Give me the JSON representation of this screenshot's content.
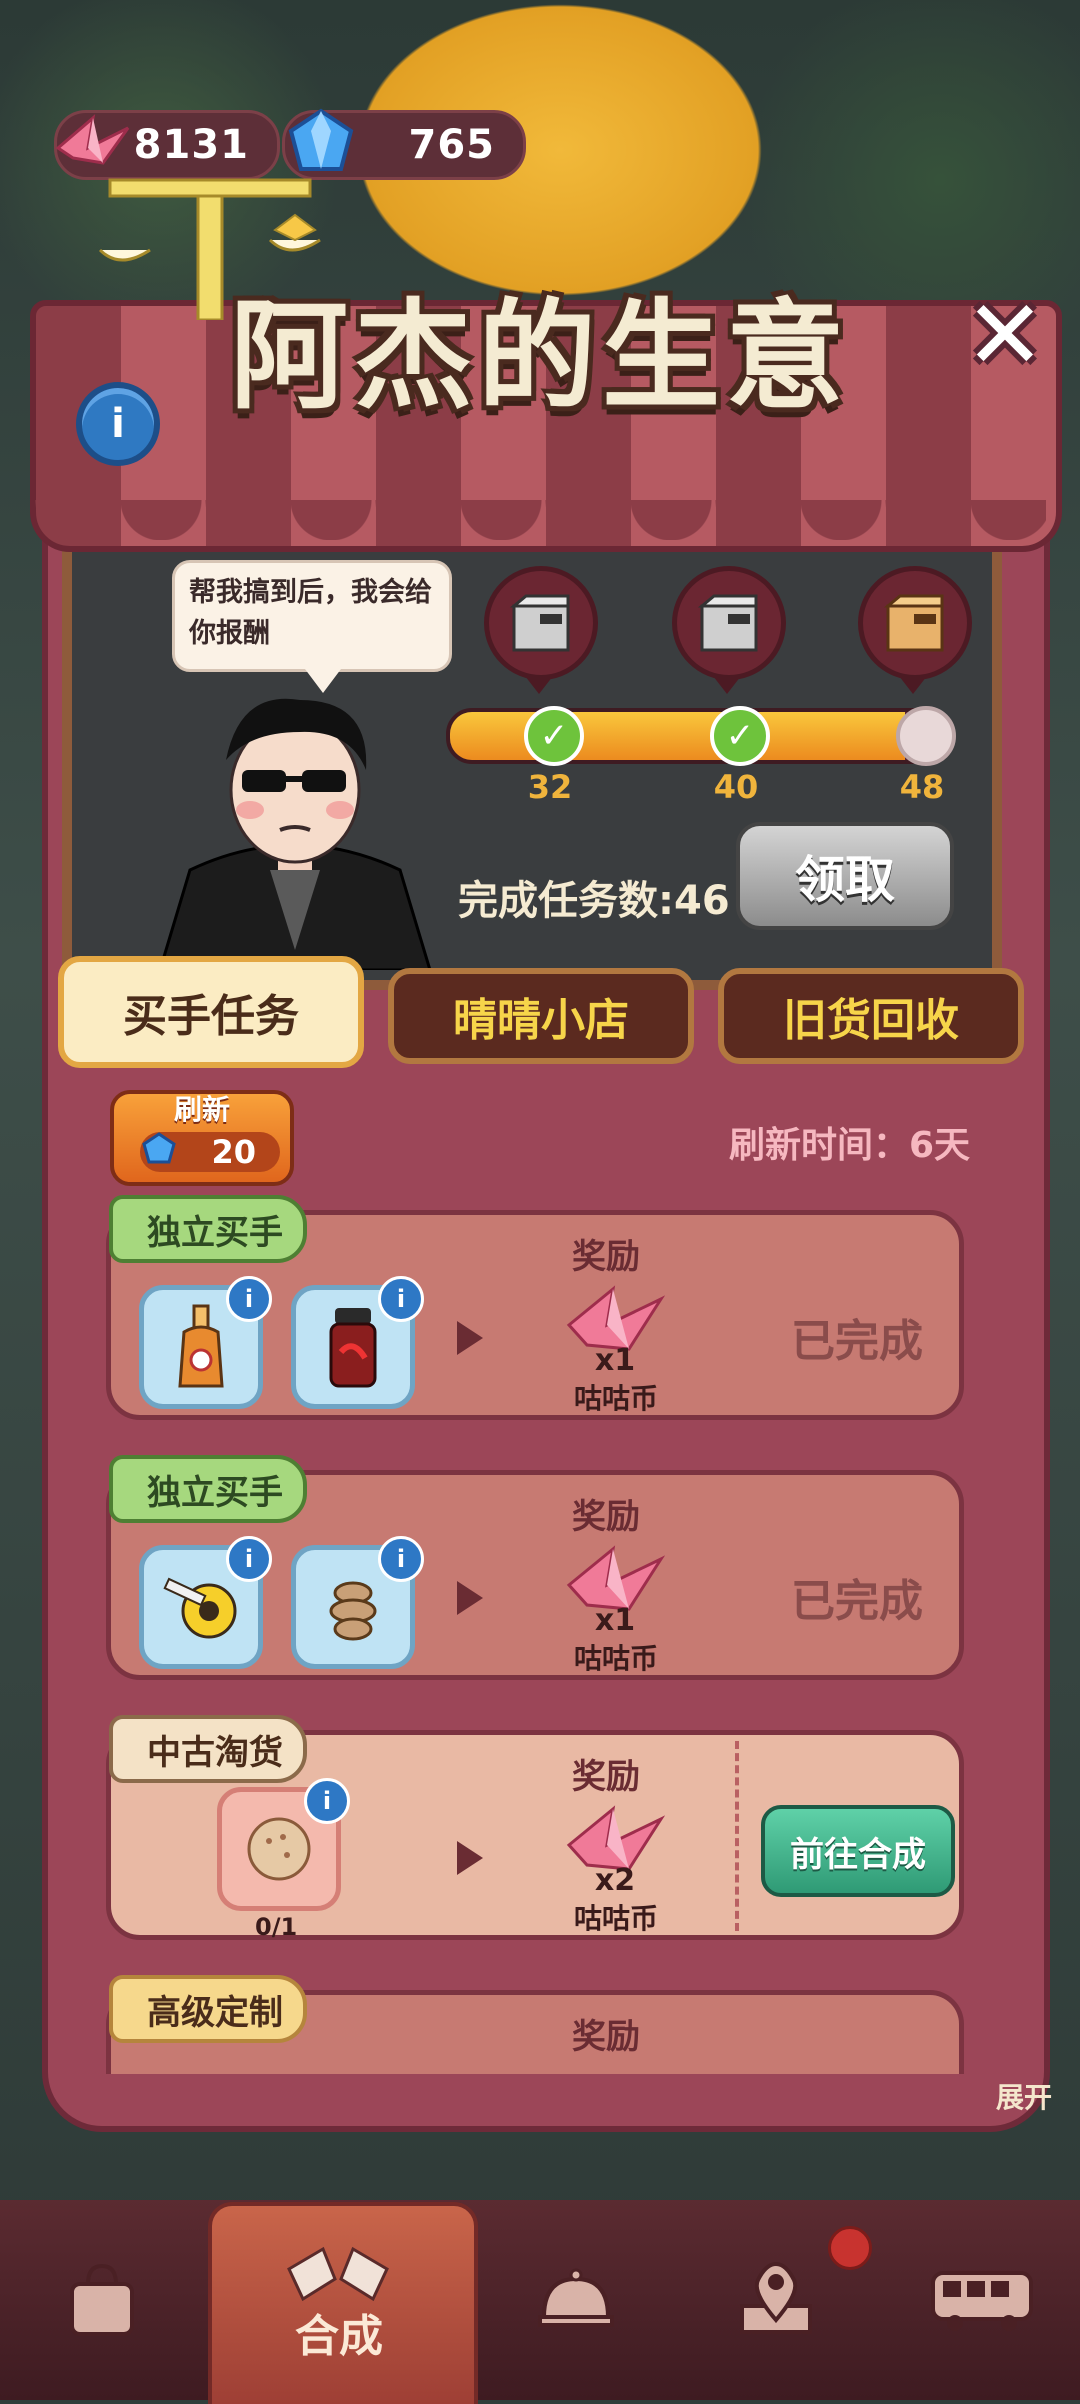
{
  "resources": {
    "crane_value": "8131",
    "gem_value": "765",
    "crane_icon": "paper-crane-icon",
    "gem_icon": "blue-gem-icon"
  },
  "header": {
    "title": "阿杰的生意",
    "close_icon": "close-x-icon",
    "info_icon": "info-icon"
  },
  "npc": {
    "speech": "帮我搞到后，我会给你报酬"
  },
  "milestones": {
    "items": [
      {
        "value": "32",
        "status": "claimed"
      },
      {
        "value": "40",
        "status": "claimed"
      },
      {
        "value": "48",
        "status": "locked"
      }
    ],
    "progress_fraction": 0.91,
    "done_label": "完成任务数:46",
    "claim_label": "领取"
  },
  "tabs": [
    {
      "label": "买手任务",
      "active": true
    },
    {
      "label": "晴晴小店",
      "active": false
    },
    {
      "label": "旧货回收",
      "active": false
    }
  ],
  "refresh": {
    "label": "刷新",
    "cost": "20",
    "time_label": "刷新时间：6天"
  },
  "tasks": [
    {
      "tag": "独立买手",
      "items": [
        "hot-sauce-bottle-icon",
        "chili-jar-icon"
      ],
      "reward_label": "奖励",
      "reward_qty": "x1",
      "reward_name": "咕咕币",
      "status": "已完成"
    },
    {
      "tag": "独立买手",
      "items": [
        "tape-measure-icon",
        "rope-coil-icon"
      ],
      "reward_label": "奖励",
      "reward_qty": "x1",
      "reward_name": "咕咕币",
      "status": "已完成"
    },
    {
      "tag": "中古淘货",
      "items": [
        "meatball-icon"
      ],
      "progress": "0/1",
      "reward_label": "奖励",
      "reward_qty": "x2",
      "reward_name": "咕咕币",
      "action": "前往合成"
    },
    {
      "tag": "高级定制",
      "reward_label": "奖励"
    }
  ],
  "side": {
    "expand_label": "展开"
  },
  "bottom_nav": {
    "active_label": "合成",
    "items": [
      "shop-bag-icon",
      "merge-hands-icon",
      "cloche-icon",
      "map-pin-icon",
      "bus-icon"
    ]
  }
}
